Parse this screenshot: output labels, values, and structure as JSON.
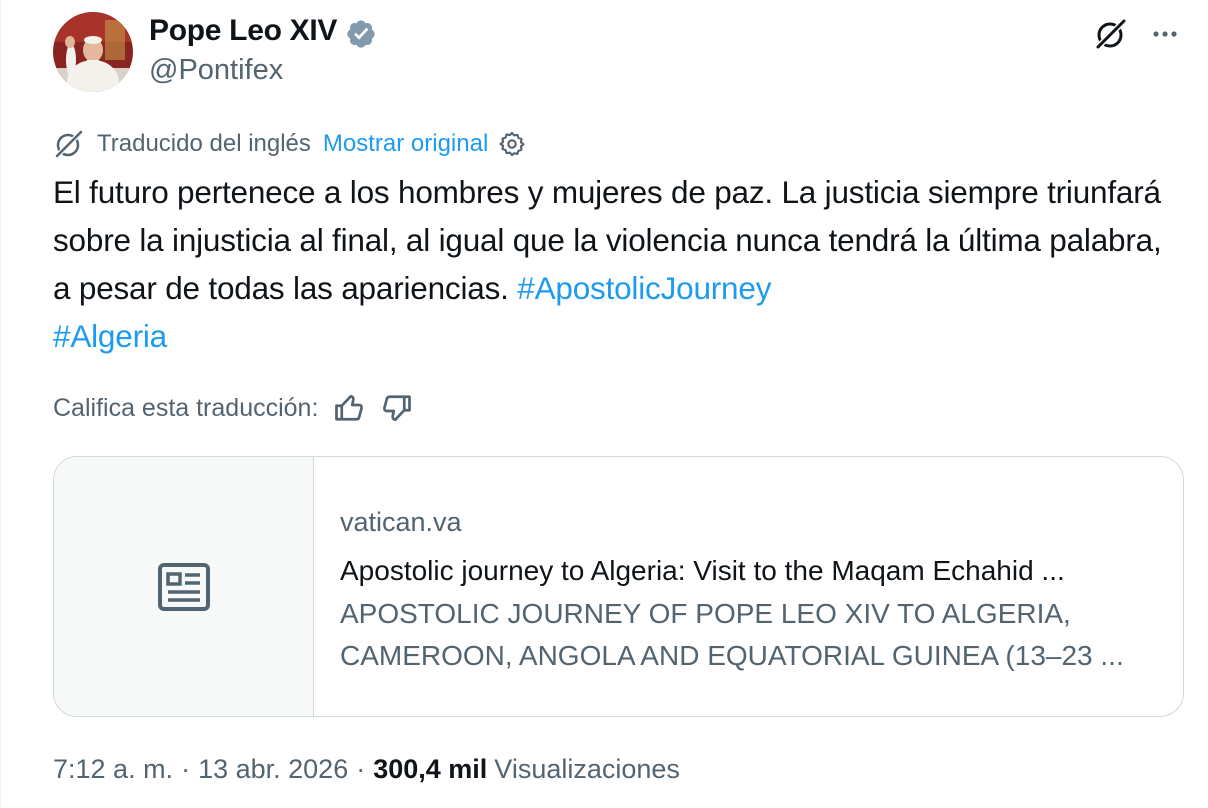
{
  "author": {
    "name": "Pope Leo XIV",
    "handle": "@Pontifex",
    "verified": true
  },
  "icons": {
    "avatar": "avatar-photo",
    "verified": "verified-badge-icon",
    "grok": "grok-icon",
    "more": "more-options-icon",
    "translate": "translate-icon",
    "settings": "settings-gear-icon",
    "thumbs_up": "thumbs-up-icon",
    "thumbs_down": "thumbs-down-icon",
    "article": "article-icon"
  },
  "translation": {
    "translated_from": "Traducido del inglés",
    "show_original": "Mostrar original"
  },
  "tweet": {
    "text": "El futuro pertenece a los hombres y mujeres de paz. La justicia siempre triunfará sobre la injusticia al final, al igual que la violencia nunca tendrá la última palabra, a pesar de todas las apariencias.",
    "hashtags": [
      "#ApostolicJourney",
      "#Algeria"
    ]
  },
  "rate": {
    "label": "Califica esta traducción:"
  },
  "link_card": {
    "domain": "vatican.va",
    "title": "Apostolic journey to Algeria: Visit to the Maqam Echahid ...",
    "description": "APOSTOLIC JOURNEY OF POPE LEO XIV TO ALGERIA, CAMEROON, ANGOLA AND EQUATORIAL GUINEA (13–23 ..."
  },
  "meta": {
    "time": "7:12 a. m.",
    "separator": "·",
    "date": "13 abr. 2026",
    "views_count": "300,4 mil",
    "views_label": "Visualizaciones"
  },
  "colors": {
    "text": "#0f1419",
    "secondary": "#536471",
    "link": "#1d9bf0",
    "border": "#cfd9de",
    "verified": "#829aab"
  }
}
